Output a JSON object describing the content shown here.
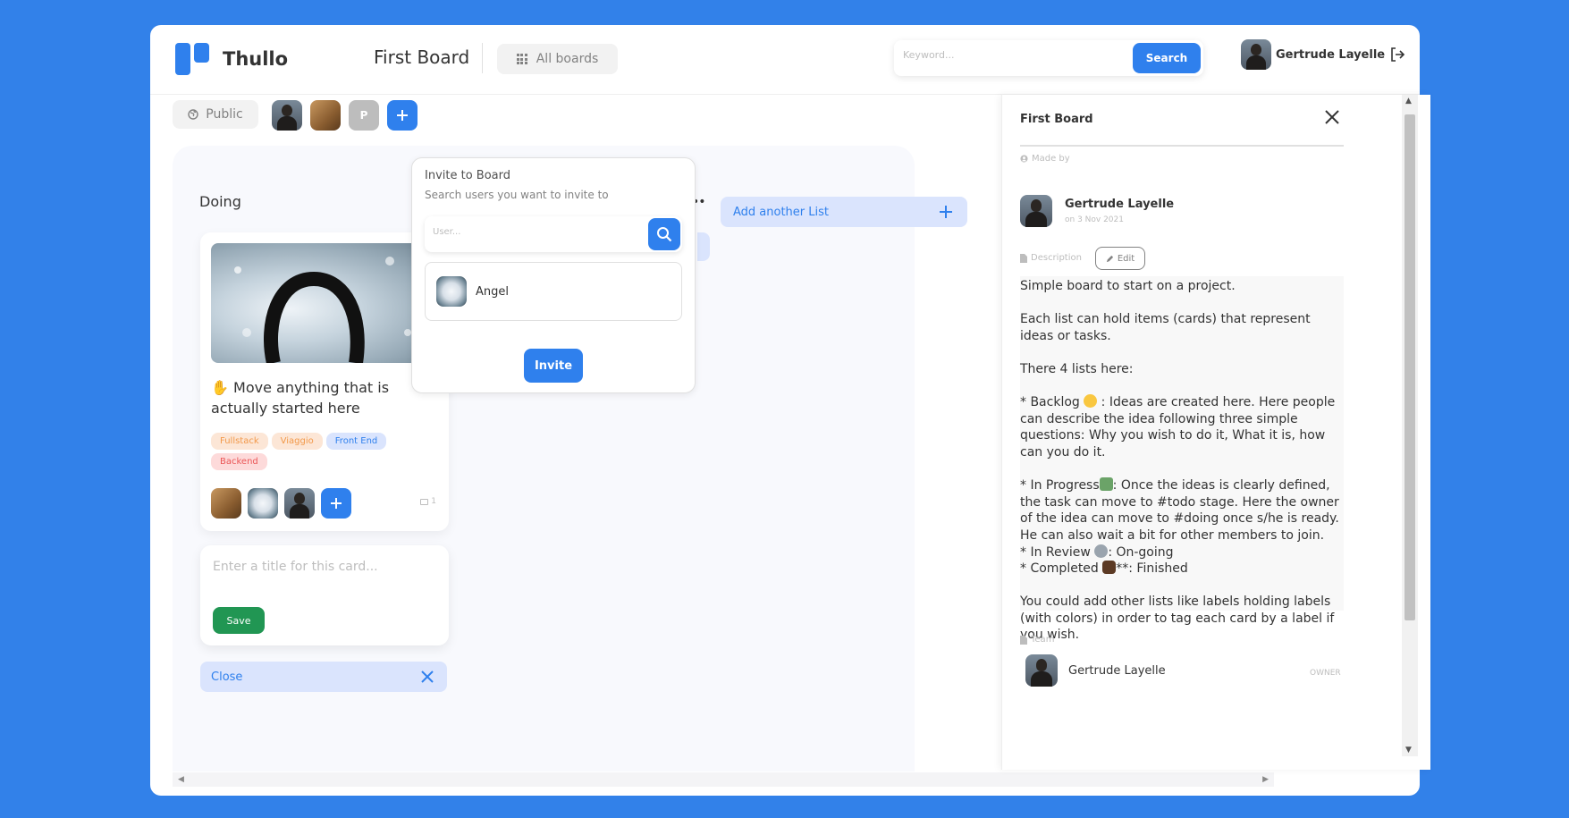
{
  "header": {
    "app_name": "Thullo",
    "board_title": "First Board",
    "all_boards_label": "All boards",
    "search_placeholder": "Keyword...",
    "search_button": "Search",
    "user_name": "Gertrude Layelle"
  },
  "toolbar": {
    "visibility_label": "Public",
    "member_initial": "P"
  },
  "board": {
    "list_title": "Doing",
    "card": {
      "emoji": "✋",
      "title": "Move anything that is actually started here",
      "tags": [
        {
          "label": "Fullstack",
          "bg": "#FCE6D6",
          "color": "#F2994A"
        },
        {
          "label": "Viaggio",
          "bg": "#FCE6D6",
          "color": "#F2994A"
        },
        {
          "label": "Front End",
          "bg": "#DAE4FD",
          "color": "#2F80ED"
        },
        {
          "label": "Backend",
          "bg": "#FDDADA",
          "color": "#EB5757"
        }
      ],
      "comment_count": "1"
    },
    "new_card_placeholder": "Enter a title for this card...",
    "save_label": "Save",
    "close_label": "Close",
    "add_list_label": "Add another List",
    "list_menu_label": "••"
  },
  "invite": {
    "title": "Invite to Board",
    "subtitle": "Search users you want to invite to",
    "placeholder": "User...",
    "result_name": "Angel",
    "button_label": "Invite"
  },
  "panel": {
    "title": "First Board",
    "made_by_label": "Made by",
    "maker_name": "Gertrude Layelle",
    "maker_date": "on 3 Nov 2021",
    "description_label": "Description",
    "edit_label": "Edit",
    "description": {
      "p1": "Simple board to start on a project.",
      "p2": "Each list can hold items (cards) that represent ideas or tasks.",
      "p3": "There 4 lists here:",
      "p4a": "* Backlog ",
      "p4b": " : Ideas are created here. Here people can describe the idea following three simple questions: Why you wish to do it, What it is, how can you do it.",
      "p5a": "*  In Progress",
      "p5b": ": Once the ideas is clearly defined, the task can move to #todo stage. Here the owner of the idea can move to #doing once s/he is ready. He can also wait a bit for other members to join.",
      "p6a": "* In Review ",
      "p6b": ": On-going",
      "p7a": "* Completed ",
      "p7b": "**: Finished",
      "p8": "You could add other lists like labels holding labels (with colors) in order to tag each card by a label if you wish."
    },
    "team_label": "Team",
    "team_member_name": "Gertrude Layelle",
    "team_member_role": "OWNER"
  },
  "colors": {
    "background": "#3281E9",
    "accent": "#2F80ED",
    "save": "#219653"
  }
}
